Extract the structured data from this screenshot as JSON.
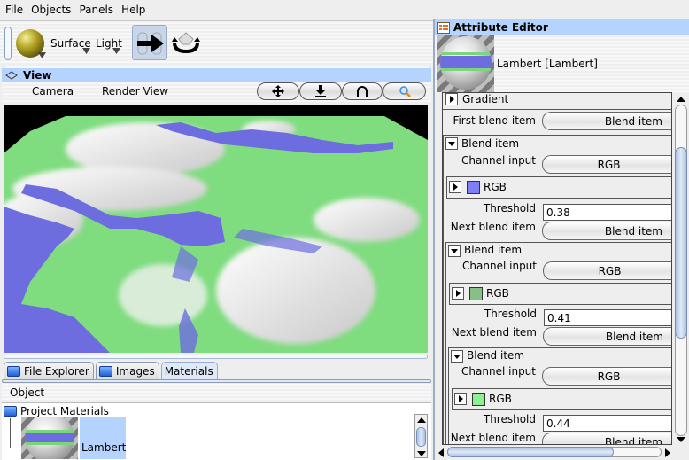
{
  "menubar": {
    "items": [
      "File",
      "Objects",
      "Panels",
      "Help"
    ]
  },
  "toolbar": {
    "surface_label": "Surface",
    "light_label": "Light",
    "material_ball_color": "#b9a92a"
  },
  "view": {
    "title": "View",
    "tabs": [
      "Camera",
      "Render View"
    ],
    "nav_buttons": [
      {
        "name": "pan-button",
        "icon": "move-icon"
      },
      {
        "name": "dolly-button",
        "icon": "dolly-icon"
      },
      {
        "name": "orbit-button",
        "icon": "orbit-icon"
      },
      {
        "name": "zoom-button",
        "icon": "magnifier-icon"
      }
    ]
  },
  "bottom_panel": {
    "tabs": [
      {
        "label": "File Explorer",
        "icon": "folder-icon",
        "active": false
      },
      {
        "label": "Images",
        "icon": "images-icon",
        "active": false
      },
      {
        "label": "Materials",
        "icon": "",
        "active": true
      }
    ],
    "menu_label": "Object",
    "tree_root": "Project Materials",
    "materials": [
      {
        "label": "Lambert",
        "selected": true
      }
    ]
  },
  "attribute_editor": {
    "title": "Attribute Editor",
    "material_name": "Lambert [Lambert]",
    "gradient_label": "Gradient",
    "first_blend_label": "First blend item",
    "first_blend_value": "Blend item",
    "blend_items": [
      {
        "header": "Blend item",
        "channel_label": "Channel input",
        "channel_value": "RGB",
        "rgb_label": "RGB",
        "color": "#7f7ff5",
        "threshold_label": "Threshold",
        "threshold": "0.38",
        "next_label": "Next blend item",
        "next_value": "Blend item"
      },
      {
        "header": "Blend item",
        "channel_label": "Channel input",
        "channel_value": "RGB",
        "rgb_label": "RGB",
        "color": "#87c087",
        "threshold_label": "Threshold",
        "threshold": "0.41",
        "next_label": "Next blend item",
        "next_value": "Blend item"
      },
      {
        "header": "Blend item",
        "channel_label": "Channel input",
        "channel_value": "RGB",
        "rgb_label": "RGB",
        "color": "#8ff08f",
        "threshold_label": "Threshold",
        "threshold": "0.44",
        "next_label": "Next blend item",
        "next_value": "Blend item"
      }
    ]
  },
  "colors": {
    "header_blue": "#b5d3ff",
    "terrain_water": "#6d6de0",
    "terrain_grass": "#7fdc7f",
    "terrain_snow": "#f4f4f4"
  }
}
